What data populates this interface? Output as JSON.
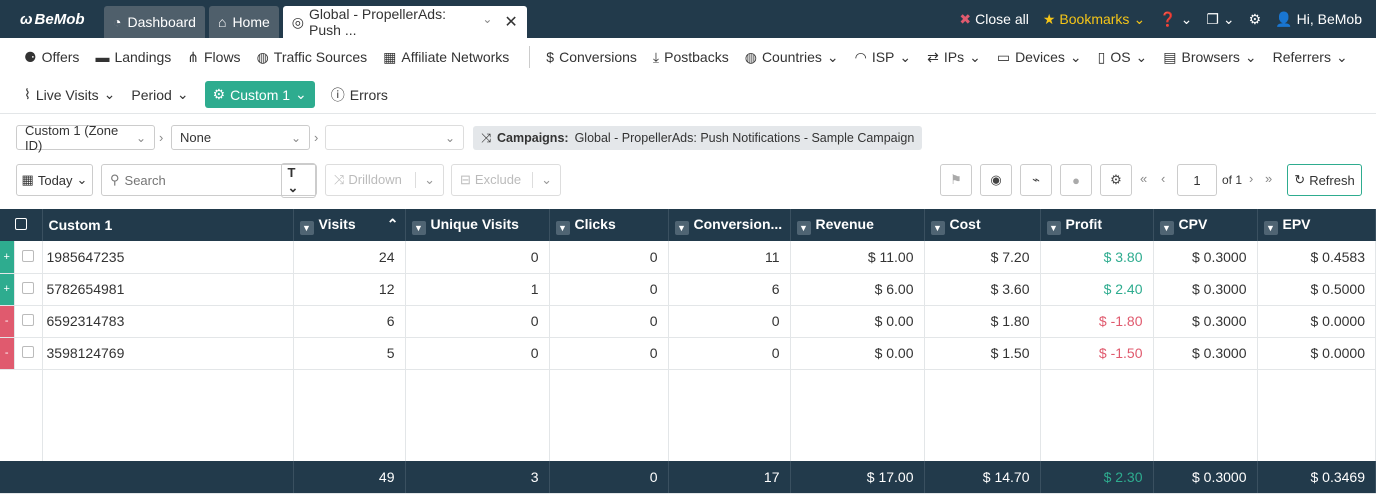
{
  "topbar": {
    "logo": "BeMob",
    "tabs": [
      {
        "label": "Dashboard"
      },
      {
        "label": "Home"
      },
      {
        "label": "Global - PropellerAds: Push ..."
      }
    ],
    "close_all": "Close all",
    "bookmarks": "Bookmarks",
    "user": "Hi, BeMob"
  },
  "nav1": [
    "Offers",
    "Landings",
    "Flows",
    "Traffic Sources",
    "Affiliate Networks",
    "Conversions",
    "Postbacks",
    "Countries",
    "ISP",
    "IPs",
    "Devices",
    "OS",
    "Browsers",
    "Referrers"
  ],
  "nav2": [
    "Live Visits",
    "Period",
    "Custom 1",
    "Errors"
  ],
  "groupings": {
    "g1": "Custom 1 (Zone ID)",
    "g2": "None",
    "g3": ""
  },
  "crumb": {
    "label": "Campaigns:",
    "value": "Global - PropellerAds: Push Notifications - Sample Campaign"
  },
  "toolbar": {
    "date": "Today",
    "search_placeholder": "Search",
    "drilldown": "Drilldown",
    "exclude": "Exclude",
    "page": "1",
    "of": "of 1",
    "refresh": "Refresh"
  },
  "columns": [
    "Custom 1",
    "Visits",
    "Unique Visits",
    "Clicks",
    "Conversion...",
    "Revenue",
    "Cost",
    "Profit",
    "CPV",
    "EPV"
  ],
  "rows": [
    {
      "mark": "+",
      "id": "1985647235",
      "visits": "24",
      "uv": "0",
      "clicks": "0",
      "conv": "11",
      "rev": "$ 11.00",
      "cost": "$ 7.20",
      "profit": "$ 3.80",
      "cpv": "$ 0.3000",
      "epv": "$ 0.4583"
    },
    {
      "mark": "+",
      "id": "5782654981",
      "visits": "12",
      "uv": "1",
      "clicks": "0",
      "conv": "6",
      "rev": "$ 6.00",
      "cost": "$ 3.60",
      "profit": "$ 2.40",
      "cpv": "$ 0.3000",
      "epv": "$ 0.5000"
    },
    {
      "mark": "-",
      "id": "6592314783",
      "visits": "6",
      "uv": "0",
      "clicks": "0",
      "conv": "0",
      "rev": "$ 0.00",
      "cost": "$ 1.80",
      "profit": "$ -1.80",
      "cpv": "$ 0.3000",
      "epv": "$ 0.0000"
    },
    {
      "mark": "-",
      "id": "3598124769",
      "visits": "5",
      "uv": "0",
      "clicks": "0",
      "conv": "0",
      "rev": "$ 0.00",
      "cost": "$ 1.50",
      "profit": "$ -1.50",
      "cpv": "$ 0.3000",
      "epv": "$ 0.0000"
    }
  ],
  "totals": {
    "visits": "49",
    "uv": "3",
    "clicks": "0",
    "conv": "17",
    "rev": "$ 17.00",
    "cost": "$ 14.70",
    "profit": "$ 2.30",
    "cpv": "$ 0.3000",
    "epv": "$ 0.3469"
  },
  "colors": {
    "header": "#223a4b",
    "accent": "#2eac8f",
    "negative": "#e05a6e"
  }
}
